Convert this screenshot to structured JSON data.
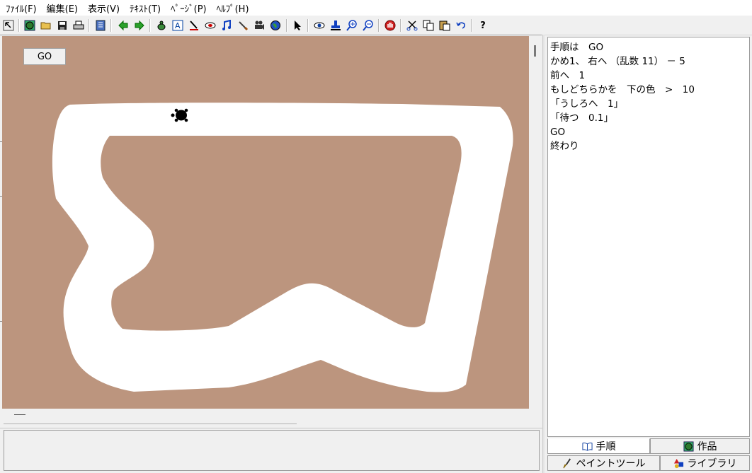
{
  "menu": {
    "items": [
      "ﾌｧｲﾙ(F)",
      "編集(E)",
      "表示(V)",
      "ﾃｷｽﾄ(T)",
      "ﾍﾟｰｼﾞ(P)",
      "ﾍﾙﾌﾟ(H)"
    ]
  },
  "toolbar": {
    "icons": [
      "cursor-mode-icon",
      "globe-icon",
      "open-folder-icon",
      "save-disk-icon",
      "print-icon",
      "page-list-icon",
      "back-arrow-icon",
      "forward-arrow-icon",
      "turtle-add-icon",
      "text-box-icon",
      "turtle-pen-icon",
      "button-object-icon",
      "music-note-icon",
      "brush-icon",
      "movie-camera-icon",
      "earth-icon",
      "pointer-icon",
      "eye-icon",
      "stamp-icon",
      "zoom-in-icon",
      "zoom-out-icon",
      "stop-hand-icon",
      "cut-icon",
      "copy-icon",
      "paste-icon",
      "undo-icon",
      "help-icon"
    ],
    "help_label": "?"
  },
  "stage": {
    "go_label": "GO",
    "background_color": "#bc957e",
    "track_color": "#ffffff",
    "turtle_color": "#000000"
  },
  "code_panel": {
    "lines": [
      "手順は　GO",
      "かめ1、 右へ （乱数 11） － 5",
      "前へ　1",
      "もしどちらかを　下の色　>　10",
      "「うしろへ　1」",
      "「待つ　0.1」",
      "GO",
      "終わり"
    ]
  },
  "tabs": {
    "procedure": "手順",
    "works": "作品",
    "paint_tool": "ペイントツール",
    "library": "ライブラリ"
  }
}
